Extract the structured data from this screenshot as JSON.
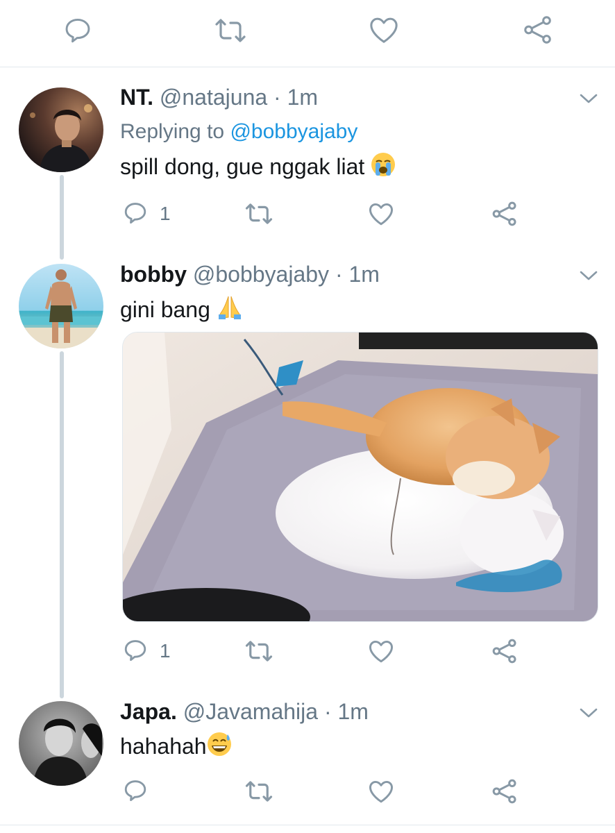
{
  "colors": {
    "accent": "#1b95e0",
    "icon": "#8899a6",
    "secondary_text": "#657786"
  },
  "top_actions": [
    "reply-icon",
    "retweet-icon",
    "like-icon",
    "share-icon"
  ],
  "tweets": [
    {
      "name": "NT.",
      "handle": "@natajuna",
      "separator": "·",
      "time": "1m",
      "replying_prefix": "Replying to",
      "replying_to": "@bobbyajaby",
      "text": "spill dong, gue nggak liat",
      "emoji": "loudly-crying-face",
      "reply_count": "1"
    },
    {
      "name": "bobby",
      "handle": "@bobbyajaby",
      "separator": "·",
      "time": "1m",
      "text": "gini bang",
      "emoji": "folded-hands",
      "media": "photo of orange and white kitten lying on a white cat on a grey rug",
      "reply_count": "1"
    },
    {
      "name": "Japa.",
      "handle": "@Javamahija",
      "separator": "·",
      "time": "1m",
      "text": "hahahah",
      "emoji": "grinning-face-with-sweat"
    }
  ]
}
